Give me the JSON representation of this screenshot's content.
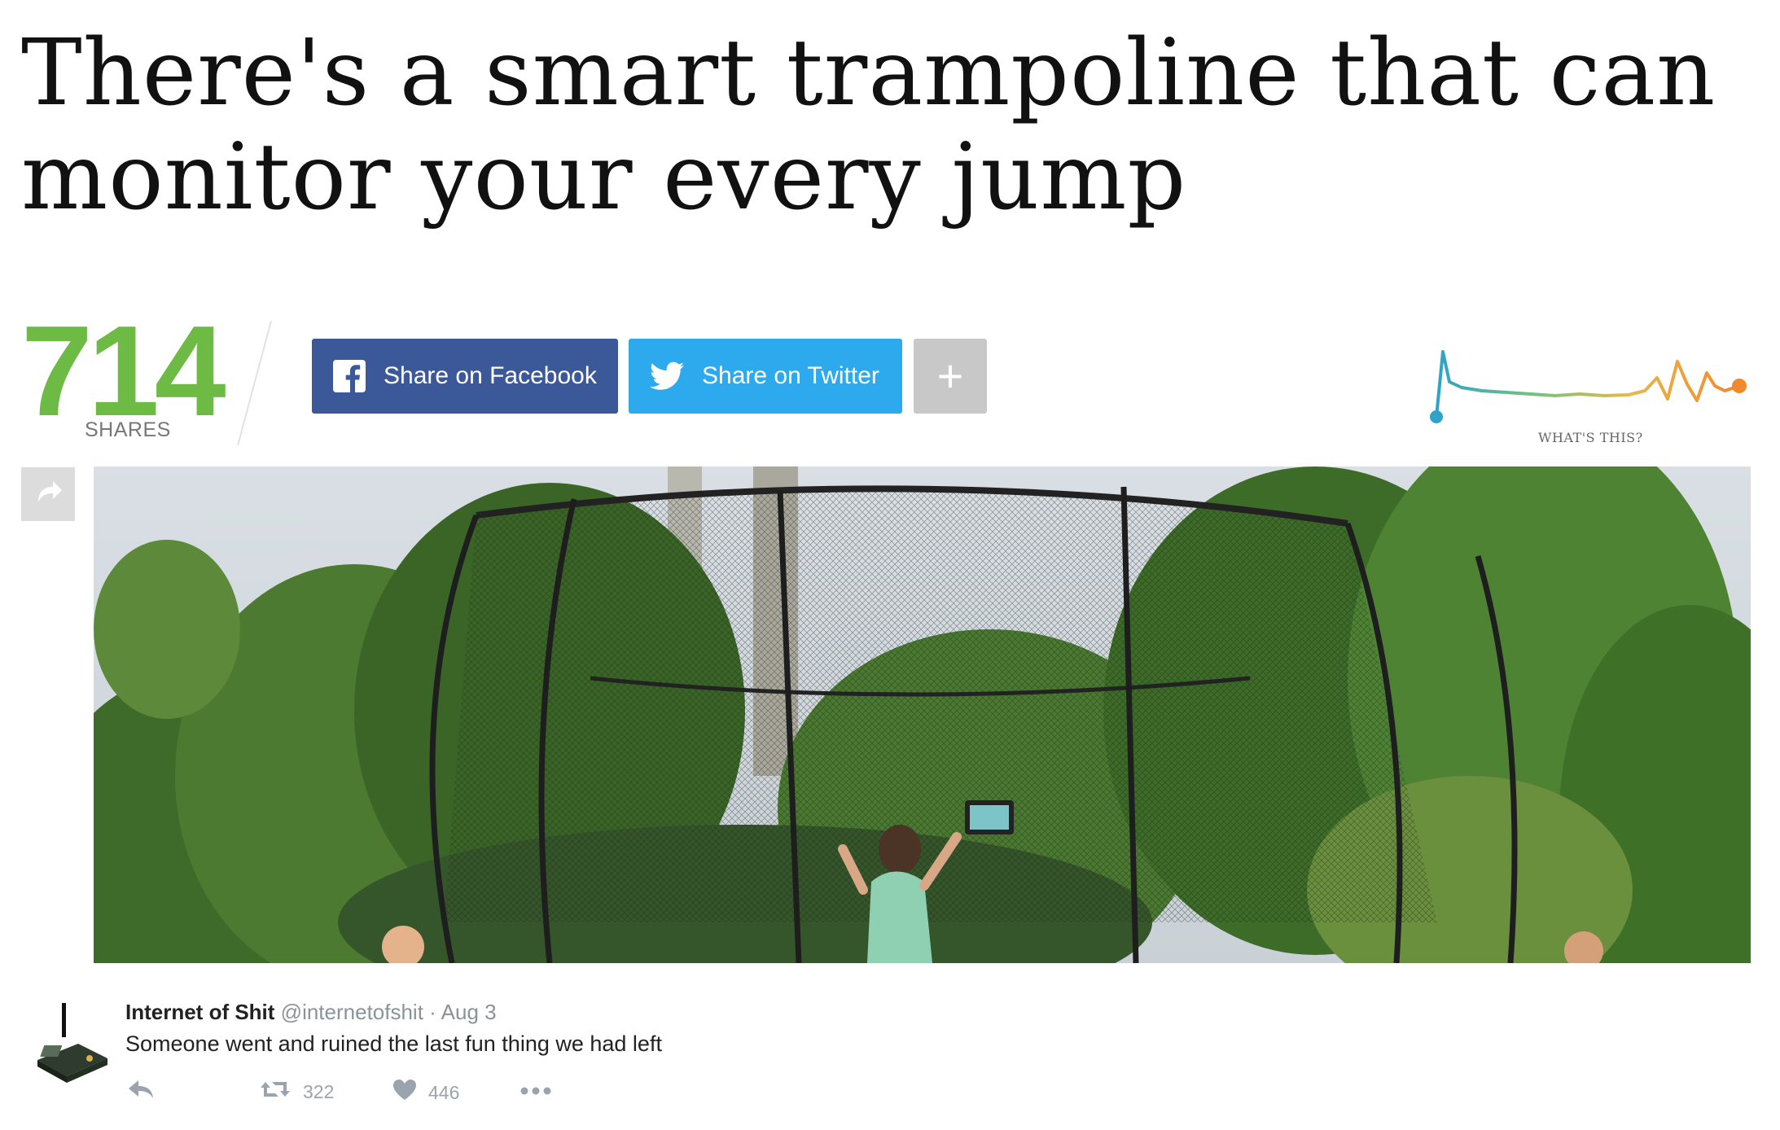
{
  "article": {
    "headline_line1": "There's a smart trampoline that can",
    "headline_line2": "monitor your every jump"
  },
  "share": {
    "count": "714",
    "count_label": "SHARES",
    "facebook_label": "Share on Facebook",
    "twitter_label": "Share on Twitter",
    "more_icon": "plus-icon",
    "trend_link": "WHAT'S THIS?"
  },
  "colors": {
    "share_count": "#6dbb45",
    "facebook": "#3b5998",
    "twitter": "#2caaed",
    "more": "#c8c8c8"
  },
  "tweet": {
    "name": "Internet of Shit",
    "handle": "@internetofshit",
    "separator": "·",
    "date": "Aug 3",
    "text": "Someone went and ruined the last fun thing we had left",
    "retweets": "322",
    "likes": "446"
  }
}
